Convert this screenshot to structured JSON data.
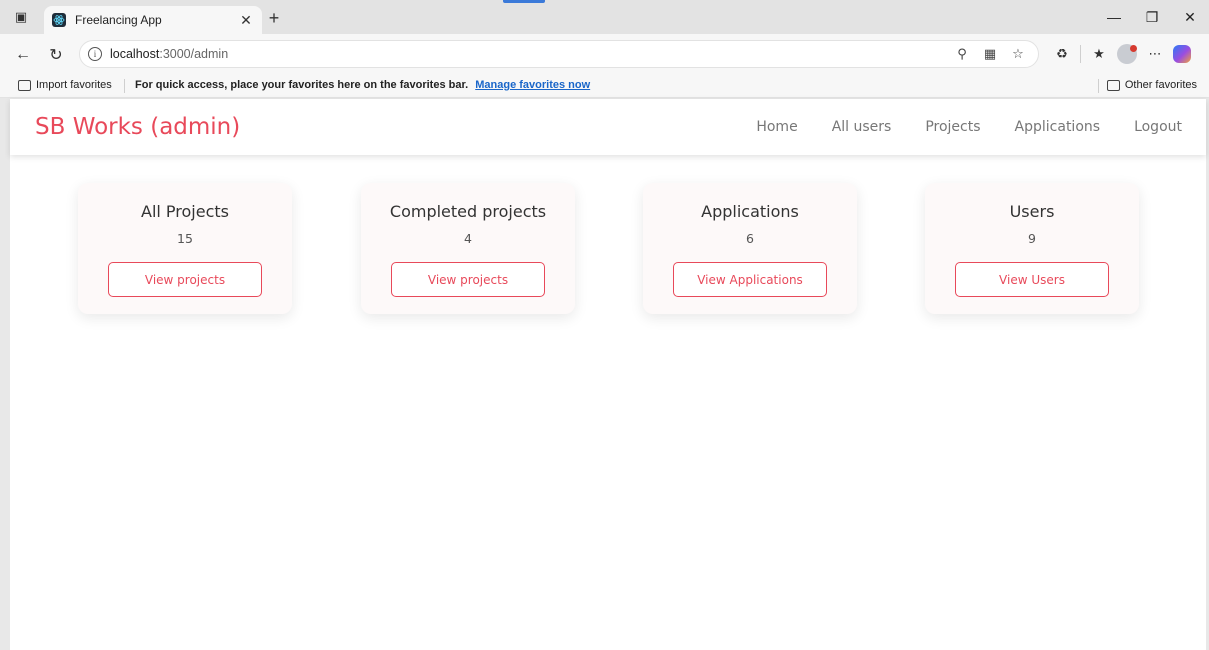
{
  "browser": {
    "tab_title": "Freelancing App",
    "url_host": "localhost",
    "url_path": ":3000/admin",
    "favorites": {
      "import_label": "Import favorites",
      "hint": "For quick access, place your favorites here on the favorites bar.",
      "manage_link": "Manage favorites now",
      "other_label": "Other favorites"
    }
  },
  "app": {
    "brand": "SB Works (admin)",
    "brand_color": "#e8495a",
    "nav": {
      "home": "Home",
      "all_users": "All users",
      "projects": "Projects",
      "applications": "Applications",
      "logout": "Logout"
    },
    "cards": [
      {
        "title": "All Projects",
        "count": "15",
        "button": "View projects"
      },
      {
        "title": "Completed projects",
        "count": "4",
        "button": "View projects"
      },
      {
        "title": "Applications",
        "count": "6",
        "button": "View Applications"
      },
      {
        "title": "Users",
        "count": "9",
        "button": "View Users"
      }
    ]
  }
}
